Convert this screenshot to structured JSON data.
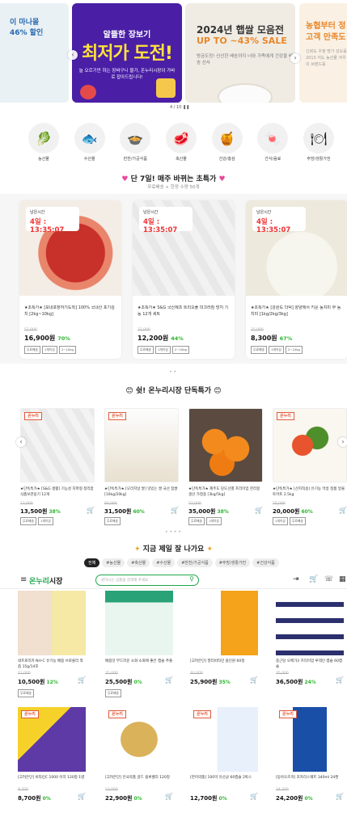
{
  "banner": {
    "left": {
      "line1": "이 마나몰",
      "line2": "46% 할인"
    },
    "main": {
      "kicker": "알뜰한 장보기",
      "headline": "최저가 도전!",
      "sub": "늘 오르기만 하는 장바구니 물가, 온누리시장이 가바로 잡아드립니다!"
    },
    "sale": {
      "line1": "2024년 햅쌀 모음전",
      "line2": "UP TO ~43% SALE",
      "sub": "방금도정! 신선한 배송까지 너와 가족에게 건강을 배송 선사"
    },
    "right": {
      "line1": "농협부터 정",
      "line2": "고객 만족도",
      "sub": "신뢰도 우정 명가 성도를 2013 지도 농산물 겨우 최강의 브랜드를"
    },
    "pager": "4 / 10 ❚❚"
  },
  "categories": [
    {
      "icon": "🥬",
      "label": "농산물"
    },
    {
      "icon": "🐟",
      "label": "수산물"
    },
    {
      "icon": "🍲",
      "label": "반찬/가공식품"
    },
    {
      "icon": "🥩",
      "label": "축산물"
    },
    {
      "icon": "🍯",
      "label": "건강/홍삼"
    },
    {
      "icon": "🍬",
      "label": "간식/음료"
    },
    {
      "icon": "🍽",
      "label": "주방/생활가전"
    }
  ],
  "deals_section": {
    "title": "단 7일! 매주 바뀌는 초특가",
    "subtitle": "무료배송 + 한정 수량 50개"
  },
  "deals": [
    {
      "timer_label": "남은시간",
      "timer": "4일 : 13:35:07",
      "name": "★초특가★ [보내포장하기도착] 100% 국내산 포기김치 [2kg~10kg]",
      "orig": "57,000",
      "price": "16,900원",
      "pct": "70%",
      "tags": [
        "무료배송",
        "1개이상",
        "2~10kg"
      ]
    },
    {
      "timer_label": "남은시간",
      "timer": "4일 : 13:35:07",
      "name": "★초특가★ S&G 국산제조 트리오풀 미끄러짐 방지 기능 12개 세트",
      "orig": "22,000",
      "price": "12,200원",
      "pct": "44%",
      "tags": [
        "무료배송",
        "1개이상",
        "2~10kg"
      ]
    },
    {
      "timer_label": "남은시간",
      "timer": "4일 : 13:35:07",
      "name": "★초특가★ [강원도 더덕] 양양에서 키운 동치미 무 동치미 [1kg/2kg/3kg]",
      "orig": "25,000",
      "price": "8,300원",
      "pct": "67%",
      "tags": [
        "무료배송",
        "1개이상",
        "2~10kg"
      ]
    }
  ],
  "deals_dots": "• •",
  "onnuri_section": {
    "title": "쉿! 온누리시장 단독특가"
  },
  "onnuri": [
    {
      "badge": "온누리",
      "name": "★단독특가★ [S&G 생활] 기능성 지퍼형 정리함 식품보관용기 12개",
      "orig": "22,000",
      "price": "13,500원",
      "pct": "38%",
      "tags": [
        "무료배송",
        "1개이상"
      ]
    },
    {
      "badge": "온누리",
      "name": "★단독특가★ [오리지날 쌀] 맛있는 쌀 국산 참쌀 [10kg/20kg]",
      "orig": "80,000",
      "price": "31,500원",
      "pct": "60%",
      "tags": [
        "무료배송"
      ]
    },
    {
      "badge": "",
      "name": "★단독특가★ 제주도 당도선별 프리미엄 한라봉 생산 가정용 [3kg/5kg]",
      "orig": "57,000",
      "price": "35,000원",
      "pct": "38%",
      "tags": [
        "무료배송",
        "1개이상"
      ]
    },
    {
      "badge": "온누리",
      "name": "★단독특가★ [산지직송] 유기농 먹방 정품 방울토마토 2.5kg",
      "orig": "50,000",
      "price": "20,000원",
      "pct": "60%",
      "tags": [
        "1개이상",
        "무료배송"
      ]
    }
  ],
  "onnuri_dots": "• • • •",
  "best_section": {
    "title": "지금 제일 잘 나가요"
  },
  "best_tabs": [
    "전체",
    "#농산물",
    "#축산물",
    "#수산물",
    "#반찬/가공식품",
    "#주방/생활가전",
    "#건강식품"
  ],
  "header": {
    "logo_a": "온누리",
    "logo_b": "시장",
    "search_placeholder": "원하시는 상품을 검색해 주세요"
  },
  "grid": [
    {
      "name": "네프로리카 NH-C 유기농 배즙 브로콜리 착즙 15g/14포",
      "orig": "11,000",
      "price": "10,500원",
      "pct": "12%",
      "tags": [
        "무료배송"
      ]
    },
    {
      "name": "배즙맛 부드러운 소화 소화에 좋은 캡슐 추출",
      "orig": "35,000",
      "price": "25,500원",
      "pct": "0%",
      "tags": [
        "무료배송"
      ]
    },
    {
      "name": "[고려은단] 멀티비타민 올인원 60정",
      "orig": "40,000",
      "price": "25,900원",
      "pct": "35%",
      "tags": []
    },
    {
      "name": "종근당 오메가3 프리미엄 루테인 캡슐 60캡슐",
      "orig": "35,000",
      "price": "36,500원",
      "pct": "24%",
      "tags": []
    },
    {
      "name": "[고려은단] 비타민C 1000 이지 120정 1병",
      "orig": "9,700",
      "price": "8,700원",
      "pct": "0%",
      "tags": []
    },
    {
      "name": "[고려은단] 안국약품 골드 블루벨리 120정",
      "orig": "23,000",
      "price": "22,900원",
      "pct": "0%",
      "tags": []
    },
    {
      "name": "[한미약품] 100억 유산균 60캡슐 2박스",
      "orig": "",
      "price": "12,700원",
      "pct": "0%",
      "tags": []
    },
    {
      "name": "[동아오츠카] 포카리스웨트 340ml 24캔",
      "orig": "34,300",
      "price": "24,200원",
      "pct": "0%",
      "tags": []
    }
  ]
}
